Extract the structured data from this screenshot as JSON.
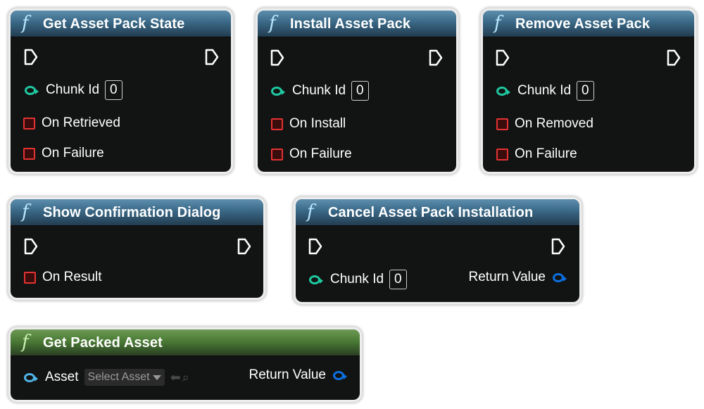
{
  "nodes": {
    "get_state": {
      "title": "Get Asset Pack State",
      "icon": "function-icon",
      "input_label": "Chunk Id",
      "input_value": "0",
      "outputs": [
        "On Retrieved",
        "On Failure"
      ]
    },
    "install": {
      "title": "Install Asset Pack",
      "icon": "function-icon",
      "input_label": "Chunk Id",
      "input_value": "0",
      "outputs": [
        "On Install",
        "On Failure"
      ]
    },
    "remove": {
      "title": "Remove Asset Pack",
      "icon": "function-icon",
      "input_label": "Chunk Id",
      "input_value": "0",
      "outputs": [
        "On Removed",
        "On Failure"
      ]
    },
    "confirm": {
      "title": "Show Confirmation Dialog",
      "icon": "function-icon",
      "outputs": [
        "On Result"
      ]
    },
    "cancel": {
      "title": "Cancel Asset Pack Installation",
      "icon": "function-icon",
      "input_label": "Chunk Id",
      "input_value": "0",
      "output_label": "Return Value"
    },
    "packed": {
      "title": "Get Packed Asset",
      "icon": "function-icon",
      "input_label": "Asset",
      "select_value": "Select Asset",
      "output_label": "Return Value"
    }
  },
  "colors": {
    "header_blue": "#3a6886",
    "header_green": "#4a7a35",
    "exec_pin": "#ffffff",
    "delegate_pin": "#e53232",
    "int_pin": "#1fc8a0",
    "object_pin": "#0c70e0"
  }
}
